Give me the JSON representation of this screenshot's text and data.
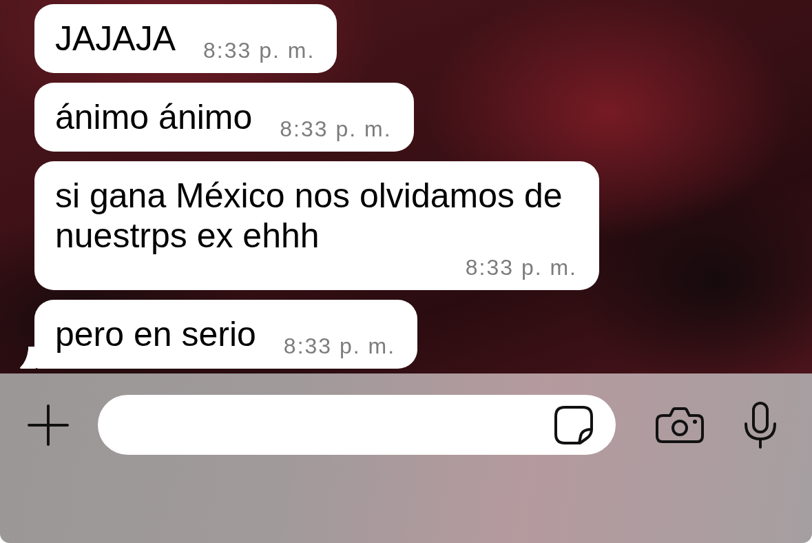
{
  "messages": [
    {
      "text": "JAJAJA",
      "time": "8:33 p. m.",
      "tail": false
    },
    {
      "text": "ánimo ánimo",
      "time": "8:33 p. m.",
      "tail": false
    },
    {
      "text": "si gana México nos olvidamos de nuestrps ex ehhh",
      "time": "8:33 p. m.",
      "tail": false
    },
    {
      "text": "pero en serio",
      "time": "8:33 p. m.",
      "tail": true
    }
  ]
}
